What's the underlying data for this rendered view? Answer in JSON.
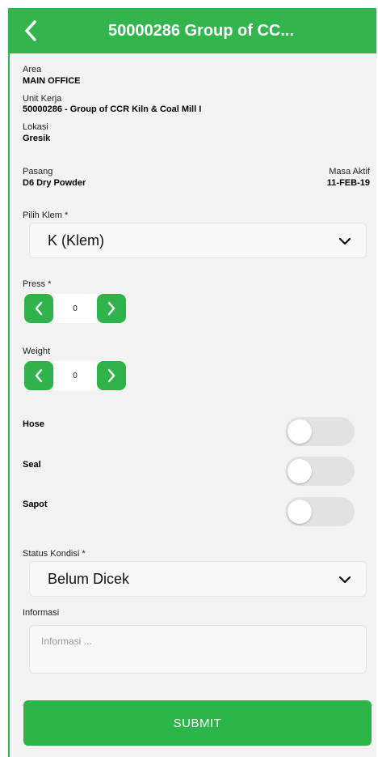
{
  "header": {
    "title": "50000286 Group of CC...",
    "back_icon": "chevron-left-icon"
  },
  "info": {
    "area_label": "Area",
    "area_value": "MAIN OFFICE",
    "unit_label": "Unit Kerja",
    "unit_value": "50000286 - Group of CCR Kiln & Coal Mill I",
    "lokasi_label": "Lokasi",
    "lokasi_value": "Gresik",
    "pasang_label": "Pasang",
    "pasang_value": "D6  Dry Powder",
    "masa_label": "Masa Aktif",
    "masa_value": "11-FEB-19"
  },
  "klem": {
    "label": "Pilih Klem *",
    "selected": "K (Klem)"
  },
  "press": {
    "label": "Press *",
    "value": "0"
  },
  "weight": {
    "label": "Weight",
    "value": "0"
  },
  "toggles": {
    "hose": {
      "label": "Hose",
      "on": false
    },
    "seal": {
      "label": "Seal",
      "on": false
    },
    "sapot": {
      "label": "Sapot",
      "on": false
    }
  },
  "status": {
    "label": "Status Kondisi *",
    "selected": "Belum Dicek"
  },
  "informasi": {
    "label": "Informasi",
    "placeholder": "Informasi ..."
  },
  "submit": {
    "label": "SUBMIT"
  },
  "colors": {
    "accent": "#32b54c",
    "background": "#f3f3f3"
  }
}
